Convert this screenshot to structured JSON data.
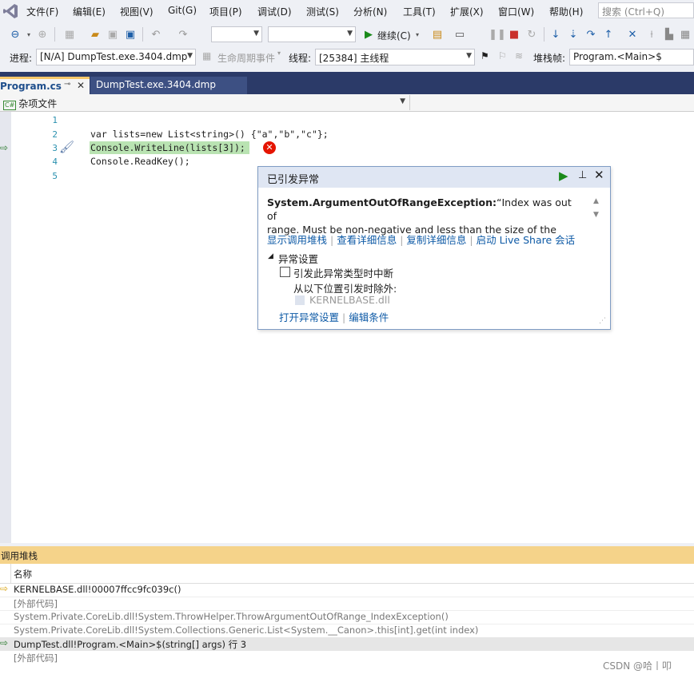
{
  "menu": [
    "文件(F)",
    "编辑(E)",
    "视图(V)",
    "Git(G)",
    "项目(P)",
    "调试(D)",
    "测试(S)",
    "分析(N)",
    "工具(T)",
    "扩展(X)",
    "窗口(W)",
    "帮助(H)"
  ],
  "search": {
    "placeholder": "搜索 (Ctrl+Q)"
  },
  "toolbar": {
    "continue_label": "继续(C)"
  },
  "debugbar": {
    "process_label": "进程:",
    "process_value": "[N/A] DumpTest.exe.3404.dmp",
    "lifecycle_label": "生命周期事件",
    "thread_label": "线程:",
    "thread_value": "[25384] 主线程",
    "stackframe_label": "堆栈帧:",
    "stackframe_value": "Program.<Main>$"
  },
  "tabs": {
    "active": "Program.cs",
    "inactive": "DumpTest.exe.3404.dmp"
  },
  "navbar": {
    "scope": "杂项文件",
    "scope_icon": "csharp-file-icon"
  },
  "code": {
    "line_numbers": [
      "1",
      "2",
      "3",
      "4",
      "5"
    ],
    "line2": "var lists=new List<string>() {\"a\",\"b\",\"c\"};",
    "line3": "Console.WriteLine(lists[3]);",
    "line4": "Console.ReadKey();"
  },
  "exception": {
    "title": "已引发异常",
    "type": "System.ArgumentOutOfRangeException:",
    "message_line1": "“Index was out of",
    "message_line2": "range. Must be non-negative and less than the size of the",
    "links": [
      "显示调用堆栈",
      "查看详细信息",
      "复制详细信息",
      "启动 Live Share 会话"
    ],
    "settings_title": "异常设置",
    "checkbox_label": "引发此异常类型时中断",
    "except_label": "从以下位置引发时除外:",
    "except_module": "KERNELBASE.dll",
    "footer_links": [
      "打开异常设置",
      "编辑条件"
    ]
  },
  "callstack": {
    "title": "调用堆栈",
    "column": "名称",
    "rows": [
      "KERNELBASE.dll!00007ffcc9fc039c()",
      "[外部代码]",
      "System.Private.CoreLib.dll!System.ThrowHelper.ThrowArgumentOutOfRange_IndexException()",
      "System.Private.CoreLib.dll!System.Collections.Generic.List<System.__Canon>.this[int].get(int index)",
      "DumpTest.dll!Program.<Main>$(string[] args) 行 3",
      "[外部代码]"
    ]
  },
  "watermark": "CSDN @哈丨叩",
  "colors": {
    "accent": "#68217a",
    "tab_bar": "#2b3a68",
    "active_tab": "#f7c76a",
    "error": "#e51400",
    "link": "#0e5aa6",
    "callstack_title": "#f5d38a"
  }
}
